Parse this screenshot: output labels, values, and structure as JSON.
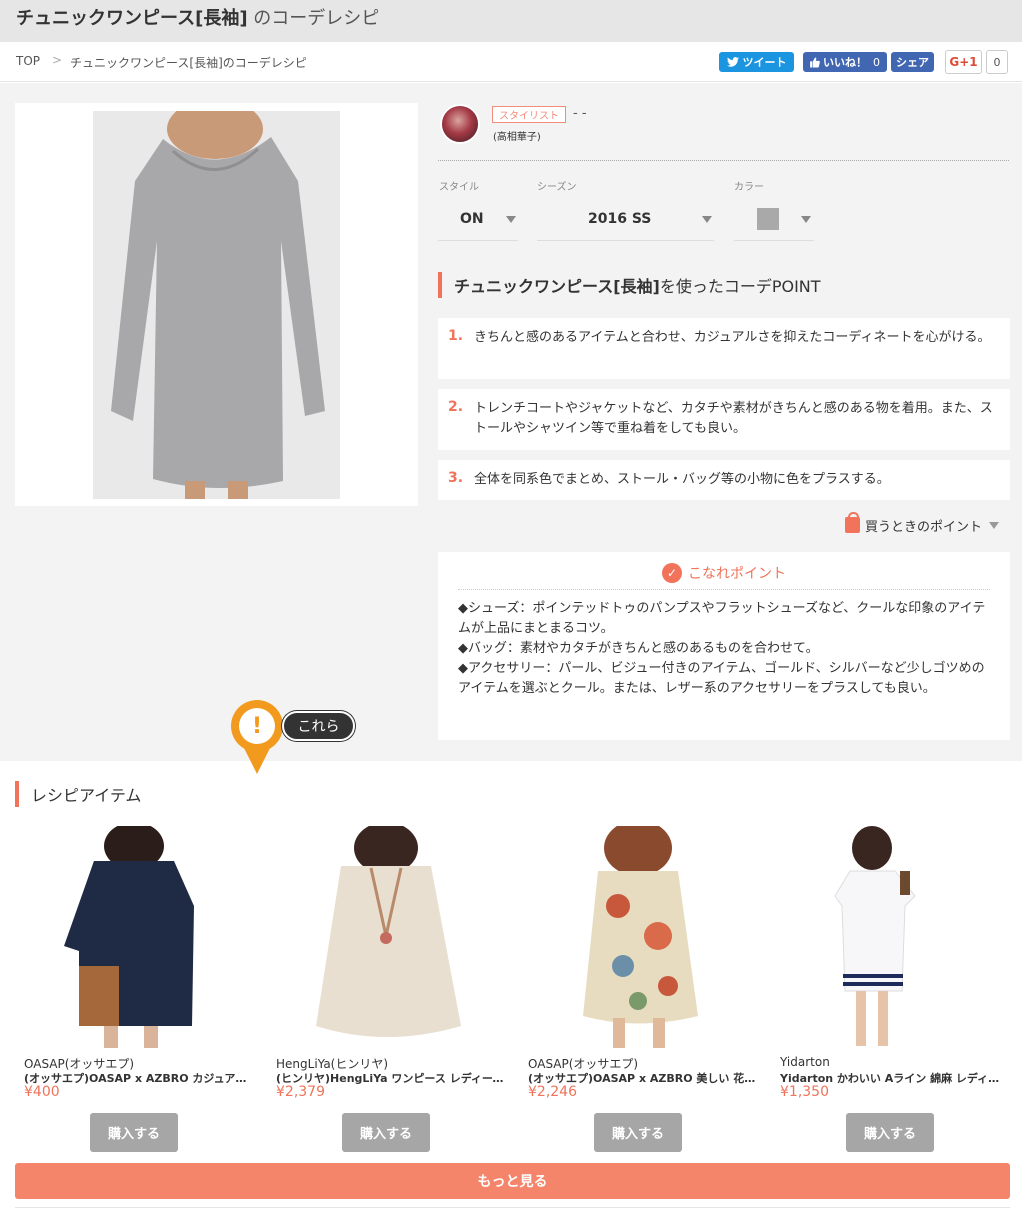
{
  "page": {
    "title_bold": "チュニックワンピース[長袖]",
    "title_rest": " のコーデレシピ"
  },
  "breadcrumb": {
    "top": "TOP",
    "separator": ">",
    "current": "チュニックワンピース[長袖]のコーデレシピ"
  },
  "social": {
    "tweet_label": "ツイート",
    "like_label": "いいね！",
    "like_count": "0",
    "share_label": "シェア",
    "gplus_label": "G+1",
    "gplus_count": "0"
  },
  "stylist": {
    "tag": "スタイリスト",
    "name": "- -",
    "sub": "(高相華子)"
  },
  "selectors": {
    "style": {
      "label": "スタイル",
      "value": "ON"
    },
    "season": {
      "label": "シーズン",
      "value": "2016 SS"
    },
    "color": {
      "label": "カラー",
      "swatch": "#a9a9a9"
    }
  },
  "point_section": {
    "heading_bold": "チュニックワンピース[長袖]",
    "heading_rest": " を使ったコーデPOINT",
    "items": [
      {
        "num": "1.",
        "text": "きちんと感のあるアイテムと合わせ、カジュアルさを抑えたコーディネートを心がける。"
      },
      {
        "num": "2.",
        "text": "トレンチコートやジャケットなど、カタチや素材がきちんと感のある物を着用。また、ストールやシャツイン等で重ね着をしても良い。"
      },
      {
        "num": "3.",
        "text": "全体を同系色でまとめ、ストール・バッグ等の小物に色をプラスする。"
      }
    ]
  },
  "buy_point": {
    "label": "買うときのポイント"
  },
  "konare": {
    "heading": "こなれポイント",
    "lines": [
      "◆シューズ：ポインテッドトゥのパンプスやフラットシューズなど、クールな印象のアイテムが上品にまとまるコツ。",
      "◆バッグ：素材やカタチがきちんと感のあるものを合わせて。",
      "◆アクセサリー：パール、ビジュー付きのアイテム、ゴールド、シルバーなど少しゴツめのアイテムを選ぶとクール。または、レザー系のアクセサリーをプラスしても良い。"
    ]
  },
  "hint": {
    "icon": "!",
    "bubble": "これら"
  },
  "recipe": {
    "heading": "レシピアイテム",
    "items": [
      {
        "brand": "OASAP(オッサエプ)",
        "title": "(オッサエプ)OASAP x AZBRO カジュアルマキシワンピース",
        "price": "¥400",
        "buy": "購入する"
      },
      {
        "brand": "HengLiYa(ヒンリヤ)",
        "title": "(ヒンリヤ)HengLiYa ワンピース レディース ゆったり",
        "price": "¥2,379",
        "buy": "購入する"
      },
      {
        "brand": "OASAP(オッサエプ)",
        "title": "(オッサエプ)OASAP x AZBRO 美しい 花柄ラウンドネック",
        "price": "¥2,246",
        "buy": "購入する"
      },
      {
        "brand": "Yidarton",
        "title": "Yidarton かわいい Aライン 綿麻 レディース ワンピース",
        "price": "¥1,350",
        "buy": "購入する"
      }
    ],
    "more": "もっと見る"
  }
}
